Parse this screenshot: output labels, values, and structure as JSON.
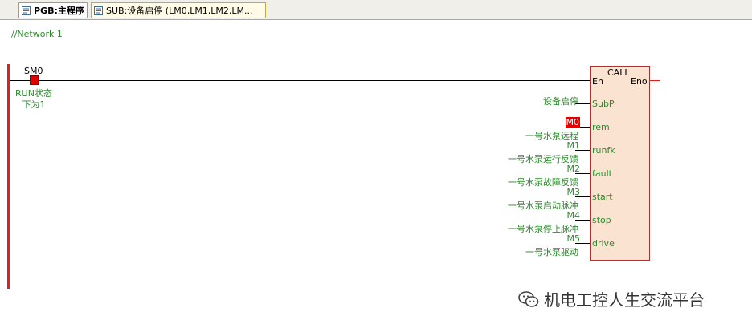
{
  "tabs": [
    {
      "label": "PGB:主程序",
      "active": true
    },
    {
      "label": "SUB:设备启停 (LM0,LM1,LM2,LM...",
      "active": false
    }
  ],
  "network": {
    "title": "//Network 1"
  },
  "contact": {
    "address": "SM0",
    "comment_line1": "RUN状态",
    "comment_line2": "下为1"
  },
  "call_block": {
    "title": "CALL",
    "en": "En",
    "eno": "Eno",
    "subp_operand": "设备启停",
    "pins": [
      {
        "name": "SubP"
      },
      {
        "name": "rem",
        "address": "M0",
        "comment": "一号水泵远程"
      },
      {
        "name": "runfk",
        "address": "M1",
        "comment": "一号水泵运行反馈"
      },
      {
        "name": "fault",
        "address": "M2",
        "comment": "一号水泵故障反馈"
      },
      {
        "name": "start",
        "address": "M3",
        "comment": "一号水泵启动脉冲"
      },
      {
        "name": "stop",
        "address": "M4",
        "comment": "一号水泵停止脉冲"
      },
      {
        "name": "drive",
        "address": "M5",
        "comment": "一号水泵驱动"
      }
    ]
  },
  "watermark": {
    "text": "机电工控人生交流平台"
  },
  "colors": {
    "comment": "#2d8a2d",
    "energized": "#e00000",
    "block_fill": "#fbe3d2"
  }
}
